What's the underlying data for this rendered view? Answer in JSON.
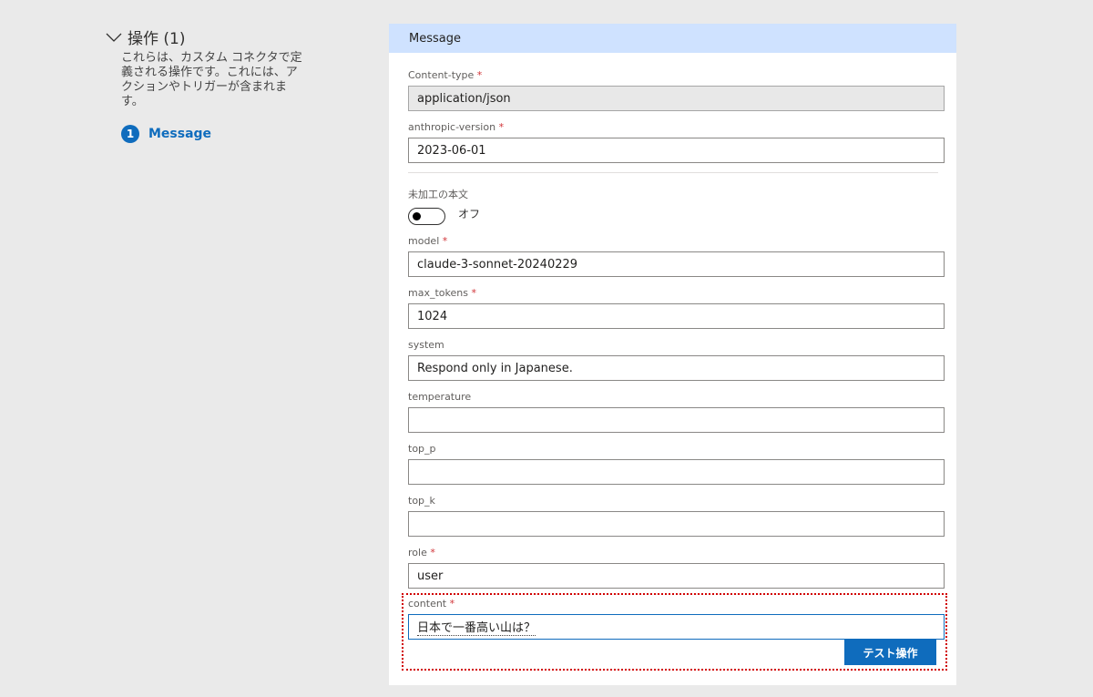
{
  "sidebar": {
    "section_title": "操作 (1)",
    "description": "これらは、カスタム コネクタで定義される操作です。これには、アクションやトリガーが含まれます。",
    "items": [
      {
        "number": "1",
        "label": "Message"
      }
    ]
  },
  "panel": {
    "title": "Message",
    "fields": {
      "content_type": {
        "label": "Content-type",
        "required": "*",
        "value": "application/json"
      },
      "anthropic_version": {
        "label": "anthropic-version",
        "required": "*",
        "value": "2023-06-01"
      },
      "raw_body": {
        "label": "未加工の本文",
        "toggle_state": "オフ"
      },
      "model": {
        "label": "model",
        "required": "*",
        "value": "claude-3-sonnet-20240229"
      },
      "max_tokens": {
        "label": "max_tokens",
        "required": "*",
        "value": "1024"
      },
      "system": {
        "label": "system",
        "value": "Respond only in Japanese."
      },
      "temperature": {
        "label": "temperature",
        "value": ""
      },
      "top_p": {
        "label": "top_p",
        "value": ""
      },
      "top_k": {
        "label": "top_k",
        "value": ""
      },
      "role": {
        "label": "role",
        "required": "*",
        "value": "user"
      },
      "content": {
        "label": "content",
        "required": "*",
        "value": "日本で一番高い山は？"
      }
    },
    "test_button": "テスト操作"
  },
  "colors": {
    "accent": "#0f6cbd",
    "header_bg": "#cfe2ff",
    "required": "#d13438",
    "highlight_border": "#d10000"
  }
}
